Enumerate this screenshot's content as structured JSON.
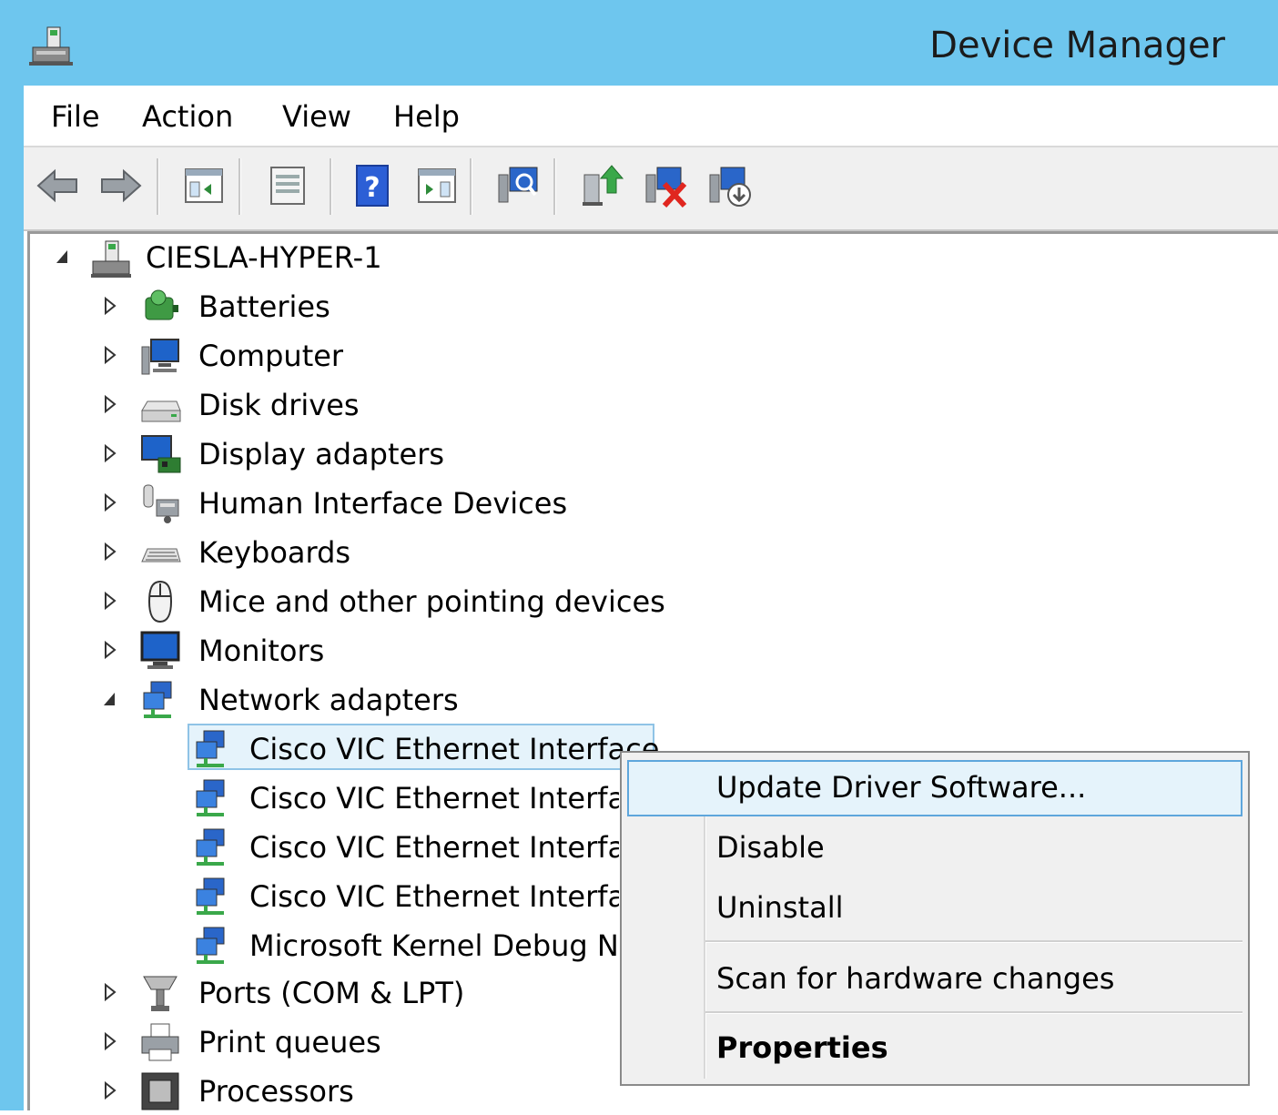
{
  "window": {
    "title": "Device Manager"
  },
  "menu": {
    "items": [
      "File",
      "Action",
      "View",
      "Help"
    ]
  },
  "toolbar": {
    "buttons": [
      "back-icon",
      "forward-icon",
      "show-hide-console-tree-icon",
      "properties-icon",
      "help-icon",
      "show-action-pane-icon",
      "scan-hardware-icon",
      "update-driver-icon",
      "uninstall-device-icon",
      "disable-device-icon"
    ]
  },
  "tree": {
    "root": "CIESLA-HYPER-1",
    "categories": [
      "Batteries",
      "Computer",
      "Disk drives",
      "Display adapters",
      "Human Interface Devices",
      "Keyboards",
      "Mice and other pointing devices",
      "Monitors",
      "Network adapters"
    ],
    "network_children": [
      "Cisco VIC Ethernet Interface",
      "Cisco VIC Ethernet Interface",
      "Cisco VIC Ethernet Interface",
      "Cisco VIC Ethernet Interface",
      "Microsoft Kernel Debug Network Adapter"
    ],
    "after": [
      "Ports (COM & LPT)",
      "Print queues",
      "Processors"
    ]
  },
  "context_menu": {
    "items": [
      "Update Driver Software...",
      "Disable",
      "Uninstall",
      "Scan for hardware changes",
      "Properties"
    ]
  },
  "colors": {
    "titlebar": "#6ec6ee",
    "selection": "#e5f3fb",
    "selection_border": "#8fc3e6",
    "menu_highlight_border": "#5ea6dc"
  }
}
